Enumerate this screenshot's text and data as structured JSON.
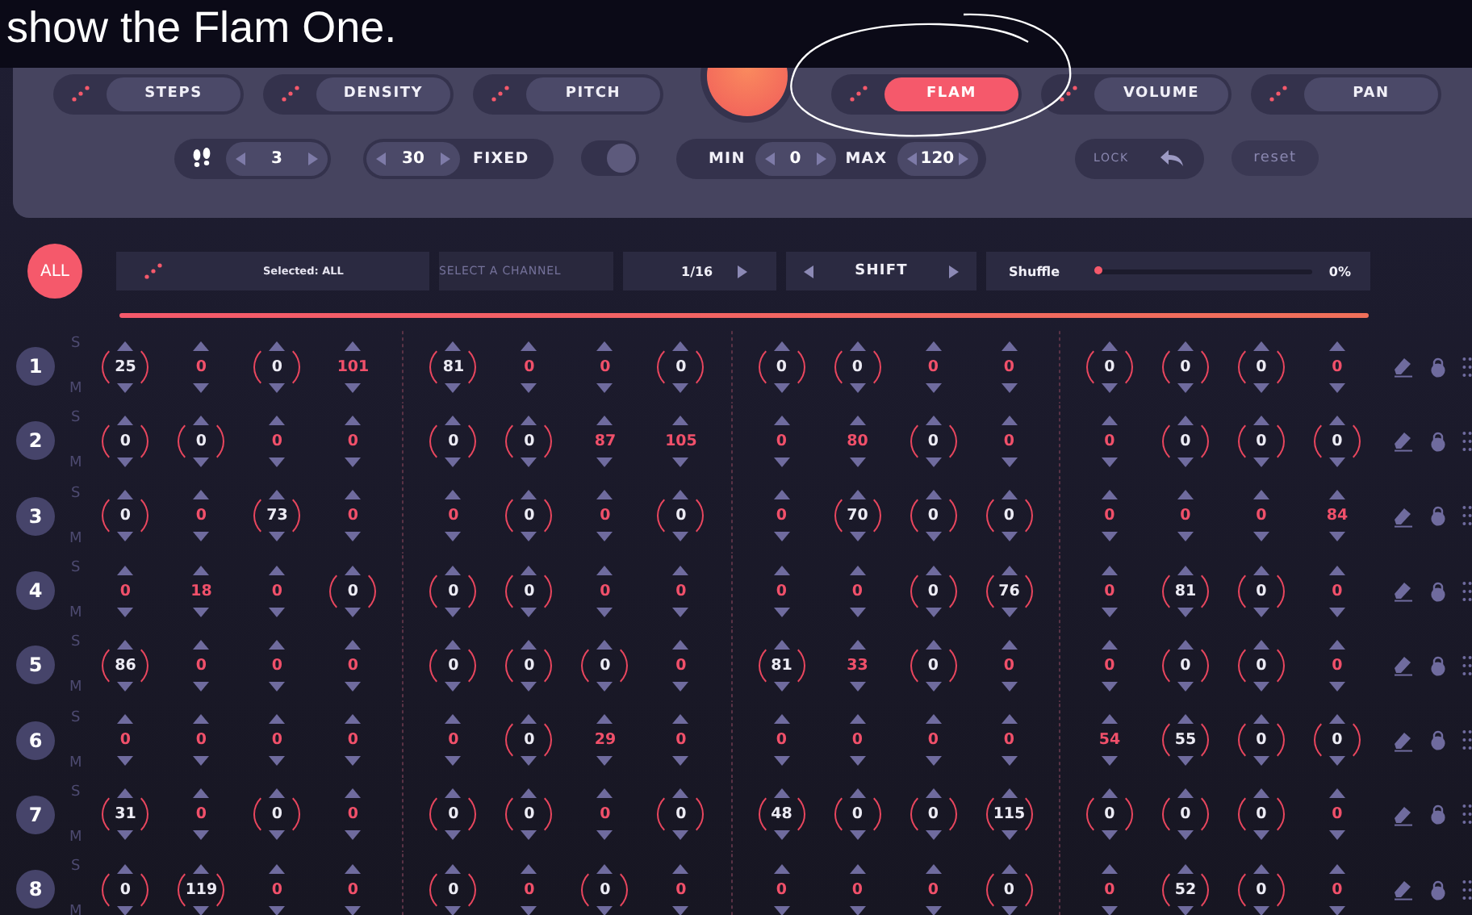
{
  "caption": "show the Flam One.",
  "modes": [
    {
      "label": "STEPS",
      "selected": false
    },
    {
      "label": "DENSITY",
      "selected": false
    },
    {
      "label": "PITCH",
      "selected": false
    },
    {
      "label": "FLAM",
      "selected": true
    },
    {
      "label": "VOLUME",
      "selected": false
    },
    {
      "label": "PAN",
      "selected": false
    }
  ],
  "steps": {
    "value": "3"
  },
  "density": {
    "value": "30",
    "label": "FIXED"
  },
  "toggle": {
    "on": true
  },
  "range": {
    "min_label": "MIN",
    "min": "0",
    "max_label": "MAX",
    "max": "120"
  },
  "lock": {
    "label": "LOCK"
  },
  "reset": {
    "label": "reset"
  },
  "all_button": "ALL",
  "selection": {
    "label": "Selected: ALL"
  },
  "channel_select": {
    "label": "SELECT A CHANNEL"
  },
  "rate": {
    "value": "1/16"
  },
  "shift": {
    "label": "SHIFT"
  },
  "shuffle": {
    "label": "Shuffle",
    "level": 0,
    "reading": "0%"
  },
  "rows": [
    {
      "number": "1",
      "solo": "S",
      "mute": "M",
      "cells": [
        {
          "value": "25",
          "active": true
        },
        {
          "value": "0",
          "active": false
        },
        {
          "value": "0",
          "active": true
        },
        {
          "value": "101",
          "active": false
        },
        {
          "value": "81",
          "active": true
        },
        {
          "value": "0",
          "active": false
        },
        {
          "value": "0",
          "active": false
        },
        {
          "value": "0",
          "active": true
        },
        {
          "value": "0",
          "active": true
        },
        {
          "value": "0",
          "active": true
        },
        {
          "value": "0",
          "active": false
        },
        {
          "value": "0",
          "active": false
        },
        {
          "value": "0",
          "active": true
        },
        {
          "value": "0",
          "active": true
        },
        {
          "value": "0",
          "active": true
        },
        {
          "value": "0",
          "active": false
        }
      ]
    },
    {
      "number": "2",
      "solo": "S",
      "mute": "M",
      "cells": [
        {
          "value": "0",
          "active": true
        },
        {
          "value": "0",
          "active": true
        },
        {
          "value": "0",
          "active": false
        },
        {
          "value": "0",
          "active": false
        },
        {
          "value": "0",
          "active": true
        },
        {
          "value": "0",
          "active": true
        },
        {
          "value": "87",
          "active": false
        },
        {
          "value": "105",
          "active": false
        },
        {
          "value": "0",
          "active": false
        },
        {
          "value": "80",
          "active": false
        },
        {
          "value": "0",
          "active": true
        },
        {
          "value": "0",
          "active": false
        },
        {
          "value": "0",
          "active": false
        },
        {
          "value": "0",
          "active": true
        },
        {
          "value": "0",
          "active": true
        },
        {
          "value": "0",
          "active": true
        }
      ]
    },
    {
      "number": "3",
      "solo": "S",
      "mute": "M",
      "cells": [
        {
          "value": "0",
          "active": true
        },
        {
          "value": "0",
          "active": false
        },
        {
          "value": "73",
          "active": true
        },
        {
          "value": "0",
          "active": false
        },
        {
          "value": "0",
          "active": false
        },
        {
          "value": "0",
          "active": true
        },
        {
          "value": "0",
          "active": false
        },
        {
          "value": "0",
          "active": true
        },
        {
          "value": "0",
          "active": false
        },
        {
          "value": "70",
          "active": true
        },
        {
          "value": "0",
          "active": true
        },
        {
          "value": "0",
          "active": true
        },
        {
          "value": "0",
          "active": false
        },
        {
          "value": "0",
          "active": false
        },
        {
          "value": "0",
          "active": false
        },
        {
          "value": "84",
          "active": false
        }
      ]
    },
    {
      "number": "4",
      "solo": "S",
      "mute": "M",
      "cells": [
        {
          "value": "0",
          "active": false
        },
        {
          "value": "18",
          "active": false
        },
        {
          "value": "0",
          "active": false
        },
        {
          "value": "0",
          "active": true
        },
        {
          "value": "0",
          "active": true
        },
        {
          "value": "0",
          "active": true
        },
        {
          "value": "0",
          "active": false
        },
        {
          "value": "0",
          "active": false
        },
        {
          "value": "0",
          "active": false
        },
        {
          "value": "0",
          "active": false
        },
        {
          "value": "0",
          "active": true
        },
        {
          "value": "76",
          "active": true
        },
        {
          "value": "0",
          "active": false
        },
        {
          "value": "81",
          "active": true
        },
        {
          "value": "0",
          "active": true
        },
        {
          "value": "0",
          "active": false
        }
      ]
    },
    {
      "number": "5",
      "solo": "S",
      "mute": "M",
      "cells": [
        {
          "value": "86",
          "active": true
        },
        {
          "value": "0",
          "active": false
        },
        {
          "value": "0",
          "active": false
        },
        {
          "value": "0",
          "active": false
        },
        {
          "value": "0",
          "active": true
        },
        {
          "value": "0",
          "active": true
        },
        {
          "value": "0",
          "active": true
        },
        {
          "value": "0",
          "active": false
        },
        {
          "value": "81",
          "active": true
        },
        {
          "value": "33",
          "active": false
        },
        {
          "value": "0",
          "active": true
        },
        {
          "value": "0",
          "active": false
        },
        {
          "value": "0",
          "active": false
        },
        {
          "value": "0",
          "active": true
        },
        {
          "value": "0",
          "active": true
        },
        {
          "value": "0",
          "active": false
        }
      ]
    },
    {
      "number": "6",
      "solo": "S",
      "mute": "M",
      "cells": [
        {
          "value": "0",
          "active": false
        },
        {
          "value": "0",
          "active": false
        },
        {
          "value": "0",
          "active": false
        },
        {
          "value": "0",
          "active": false
        },
        {
          "value": "0",
          "active": false
        },
        {
          "value": "0",
          "active": true
        },
        {
          "value": "29",
          "active": false
        },
        {
          "value": "0",
          "active": false
        },
        {
          "value": "0",
          "active": false
        },
        {
          "value": "0",
          "active": false
        },
        {
          "value": "0",
          "active": false
        },
        {
          "value": "0",
          "active": false
        },
        {
          "value": "54",
          "active": false
        },
        {
          "value": "55",
          "active": true
        },
        {
          "value": "0",
          "active": true
        },
        {
          "value": "0",
          "active": true
        }
      ]
    },
    {
      "number": "7",
      "solo": "S",
      "mute": "M",
      "cells": [
        {
          "value": "31",
          "active": true
        },
        {
          "value": "0",
          "active": false
        },
        {
          "value": "0",
          "active": true
        },
        {
          "value": "0",
          "active": false
        },
        {
          "value": "0",
          "active": true
        },
        {
          "value": "0",
          "active": true
        },
        {
          "value": "0",
          "active": false
        },
        {
          "value": "0",
          "active": true
        },
        {
          "value": "48",
          "active": true
        },
        {
          "value": "0",
          "active": true
        },
        {
          "value": "0",
          "active": true
        },
        {
          "value": "115",
          "active": true
        },
        {
          "value": "0",
          "active": true
        },
        {
          "value": "0",
          "active": true
        },
        {
          "value": "0",
          "active": true
        },
        {
          "value": "0",
          "active": false
        }
      ]
    },
    {
      "number": "8",
      "solo": "S",
      "mute": "M",
      "cells": [
        {
          "value": "0",
          "active": true
        },
        {
          "value": "119",
          "active": true
        },
        {
          "value": "0",
          "active": false
        },
        {
          "value": "0",
          "active": false
        },
        {
          "value": "0",
          "active": true
        },
        {
          "value": "0",
          "active": false
        },
        {
          "value": "0",
          "active": true
        },
        {
          "value": "0",
          "active": false
        },
        {
          "value": "0",
          "active": false
        },
        {
          "value": "0",
          "active": false
        },
        {
          "value": "0",
          "active": false
        },
        {
          "value": "0",
          "active": true
        },
        {
          "value": "0",
          "active": false
        },
        {
          "value": "52",
          "active": true
        },
        {
          "value": "0",
          "active": true
        },
        {
          "value": "0",
          "active": false
        }
      ]
    }
  ]
}
